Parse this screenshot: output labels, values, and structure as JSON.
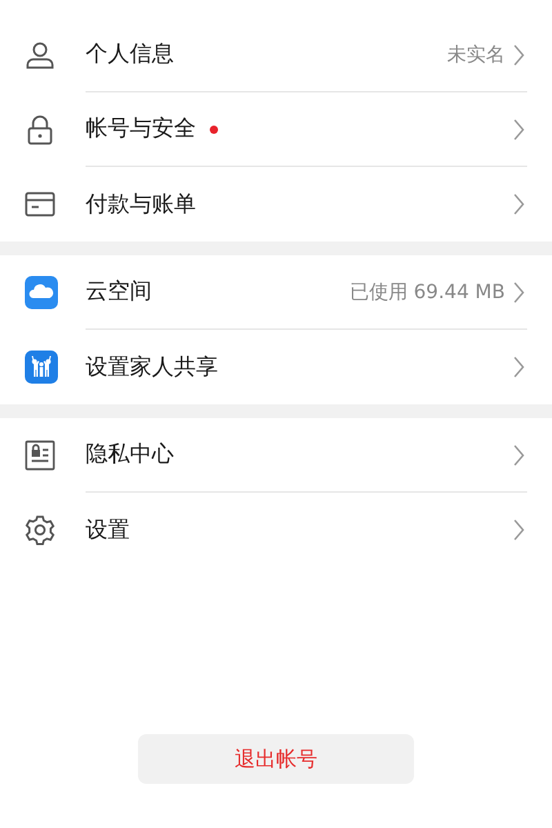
{
  "groups": [
    {
      "items": [
        {
          "kind": "person",
          "label": "个人信息",
          "value": "未实名",
          "badge": false
        },
        {
          "kind": "lock",
          "label": "帐号与安全",
          "badge": true
        },
        {
          "kind": "card",
          "label": "付款与账单",
          "badge": false
        }
      ]
    },
    {
      "items": [
        {
          "kind": "cloud",
          "label": "云空间",
          "value": "已使用 69.44 MB",
          "badge": false
        },
        {
          "kind": "family",
          "label": "设置家人共享",
          "badge": false
        }
      ]
    },
    {
      "items": [
        {
          "kind": "privacy",
          "label": "隐私中心",
          "badge": false
        },
        {
          "kind": "gear",
          "label": "设置",
          "badge": false
        }
      ]
    }
  ],
  "logout_button": "退出帐号"
}
